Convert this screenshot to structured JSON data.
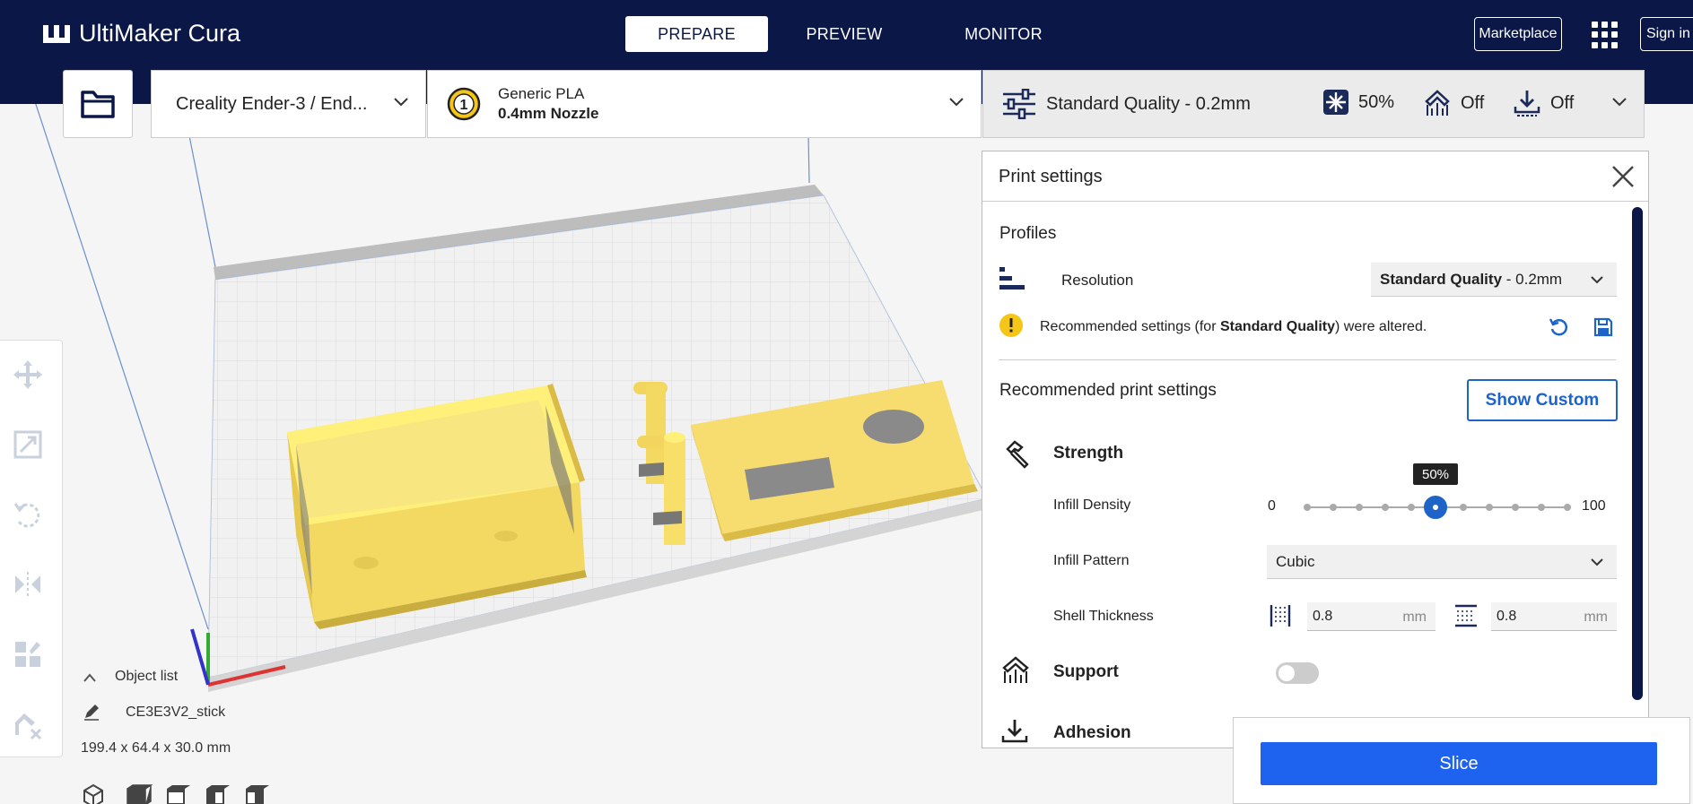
{
  "app": {
    "logo_text": "UltiMaker Cura"
  },
  "nav": {
    "tabs": [
      {
        "label": "PREPARE",
        "active": true
      },
      {
        "label": "PREVIEW",
        "active": false
      },
      {
        "label": "MONITOR",
        "active": false
      }
    ],
    "marketplace_label": "Marketplace",
    "signin_label": "Sign in"
  },
  "toolbar": {
    "printer": "Creality Ender-3 / End...",
    "material": {
      "name": "Generic PLA",
      "nozzle": "0.4mm Nozzle",
      "extruder_number": "1"
    },
    "quality": {
      "profile": "Standard Quality - 0.2mm",
      "infill": "50%",
      "support": "Off",
      "adhesion": "Off"
    }
  },
  "object_list": {
    "header": "Object list",
    "object_name": "CE3E3V2_stick",
    "dimensions": "199.4 x 64.4 x 30.0 mm"
  },
  "print_settings": {
    "title": "Print settings",
    "profiles_label": "Profiles",
    "resolution_label": "Resolution",
    "resolution_value_bold": "Standard Quality",
    "resolution_value_rest": " - 0.2mm",
    "warning_prefix": "Recommended settings (for ",
    "warning_bold": "Standard Quality",
    "warning_suffix": ") were altered.",
    "recommended_label": "Recommended print settings",
    "show_custom_label": "Show Custom",
    "strength_label": "Strength",
    "infill_density_label": "Infill Density",
    "infill_min": "0",
    "infill_max": "100",
    "infill_value": 50,
    "infill_tooltip": "50%",
    "infill_pattern_label": "Infill Pattern",
    "infill_pattern_value": "Cubic",
    "shell_thickness_label": "Shell Thickness",
    "wall_thickness": "0.8",
    "top_bottom_thickness": "0.8",
    "unit_mm": "mm",
    "support_label": "Support",
    "support_enabled": false,
    "adhesion_label": "Adhesion",
    "adhesion_enabled": false
  },
  "slice": {
    "label": "Slice"
  },
  "colors": {
    "header_bg": "#0b1747",
    "accent_blue": "#1e63c8",
    "slice_blue": "#1e63f0",
    "model_yellow": "#f7dc6f",
    "warning_yellow": "#f5c518"
  }
}
